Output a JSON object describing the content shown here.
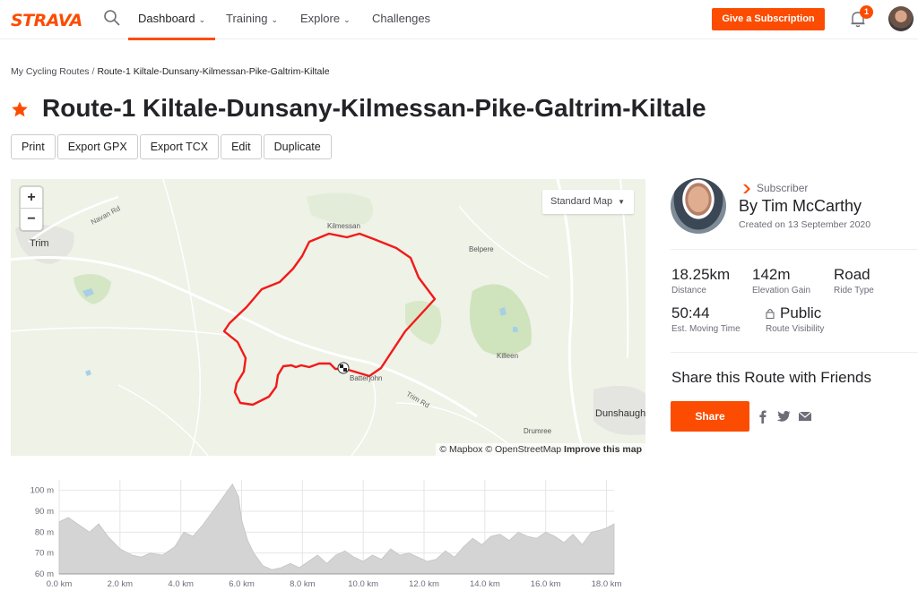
{
  "nav": {
    "logo": "STRAVA",
    "dashboard": "Dashboard",
    "training": "Training",
    "explore": "Explore",
    "challenges": "Challenges",
    "give_subscription": "Give a Subscription",
    "notification_count": "1",
    "accent_color": "#fc4c02"
  },
  "breadcrumb": {
    "parent": "My Cycling Routes",
    "separator": "/",
    "current": "Route-1 Kiltale-Dunsany-Kilmessan-Pike-Galtrim-Kiltale"
  },
  "page": {
    "title": "Route-1 Kiltale-Dunsany-Kilmessan-Pike-Galtrim-Kiltale"
  },
  "actions": [
    "Print",
    "Export GPX",
    "Export TCX",
    "Edit",
    "Duplicate"
  ],
  "map": {
    "zoom_in": "+",
    "zoom_out": "−",
    "map_type": "Standard Map",
    "places": {
      "trim": "Trim",
      "kilmessan": "Kilmessan",
      "belpere": "Belpere",
      "killeen": "Killeen",
      "batterjohn": "Batterjohn",
      "dunshaughlin": "Dunshaughl",
      "drumree": "Drumree"
    },
    "roads": {
      "navan": "Navan Rd",
      "trim": "Trim Rd"
    },
    "attribution": {
      "mapbox": "© Mapbox",
      "osm": "© OpenStreetMap",
      "improve": "Improve this map"
    }
  },
  "athlete": {
    "badge": "Subscriber",
    "name": "By Tim McCarthy",
    "created": "Created on 13 September 2020"
  },
  "stats": {
    "distance": {
      "value": "18.25km",
      "label": "Distance"
    },
    "elevation": {
      "value": "142m",
      "label": "Elevation Gain"
    },
    "ride_type": {
      "value": "Road",
      "label": "Ride Type"
    },
    "moving_time": {
      "value": "50:44",
      "label": "Est. Moving Time"
    },
    "visibility": {
      "value": "Public",
      "label": "Route Visibility"
    }
  },
  "share": {
    "title": "Share this Route with Friends",
    "button": "Share",
    "icons": [
      "facebook-icon",
      "twitter-icon",
      "email-icon"
    ]
  },
  "chart_data": {
    "type": "area",
    "title": "",
    "xlabel": "",
    "ylabel": "",
    "xlim": [
      0,
      18.25
    ],
    "ylim": [
      60,
      105
    ],
    "x_ticks": [
      "0.0 km",
      "2.0 km",
      "4.0 km",
      "6.0 km",
      "8.0 km",
      "10.0 km",
      "12.0 km",
      "14.0 km",
      "16.0 km",
      "18.0 km"
    ],
    "y_ticks": [
      "60 m",
      "70 m",
      "80 m",
      "90 m",
      "100 m"
    ],
    "grid": true,
    "x": [
      0,
      0.3,
      0.6,
      1.0,
      1.3,
      1.6,
      2.0,
      2.4,
      2.7,
      3.0,
      3.4,
      3.8,
      4.1,
      4.4,
      4.7,
      5.0,
      5.3,
      5.5,
      5.7,
      5.9,
      6.0,
      6.2,
      6.4,
      6.7,
      7.0,
      7.3,
      7.6,
      7.9,
      8.2,
      8.5,
      8.8,
      9.1,
      9.4,
      9.7,
      10.0,
      10.3,
      10.6,
      10.9,
      11.2,
      11.5,
      11.8,
      12.1,
      12.4,
      12.7,
      13.0,
      13.3,
      13.6,
      13.9,
      14.2,
      14.5,
      14.8,
      15.1,
      15.4,
      15.7,
      16.0,
      16.3,
      16.6,
      16.9,
      17.2,
      17.5,
      17.8,
      18.0,
      18.25
    ],
    "y": [
      85,
      87,
      84,
      80,
      84,
      78,
      72,
      69,
      68,
      70,
      69,
      73,
      80,
      78,
      83,
      89,
      95,
      99,
      103,
      97,
      86,
      76,
      70,
      64,
      62,
      63,
      65,
      63,
      66,
      69,
      65,
      69,
      71,
      68,
      66,
      69,
      67,
      72,
      69,
      70,
      68,
      66,
      67,
      71,
      68,
      73,
      77,
      74,
      78,
      79,
      76,
      80,
      78,
      77,
      80,
      78,
      75,
      79,
      74,
      80,
      81,
      82,
      84
    ]
  }
}
